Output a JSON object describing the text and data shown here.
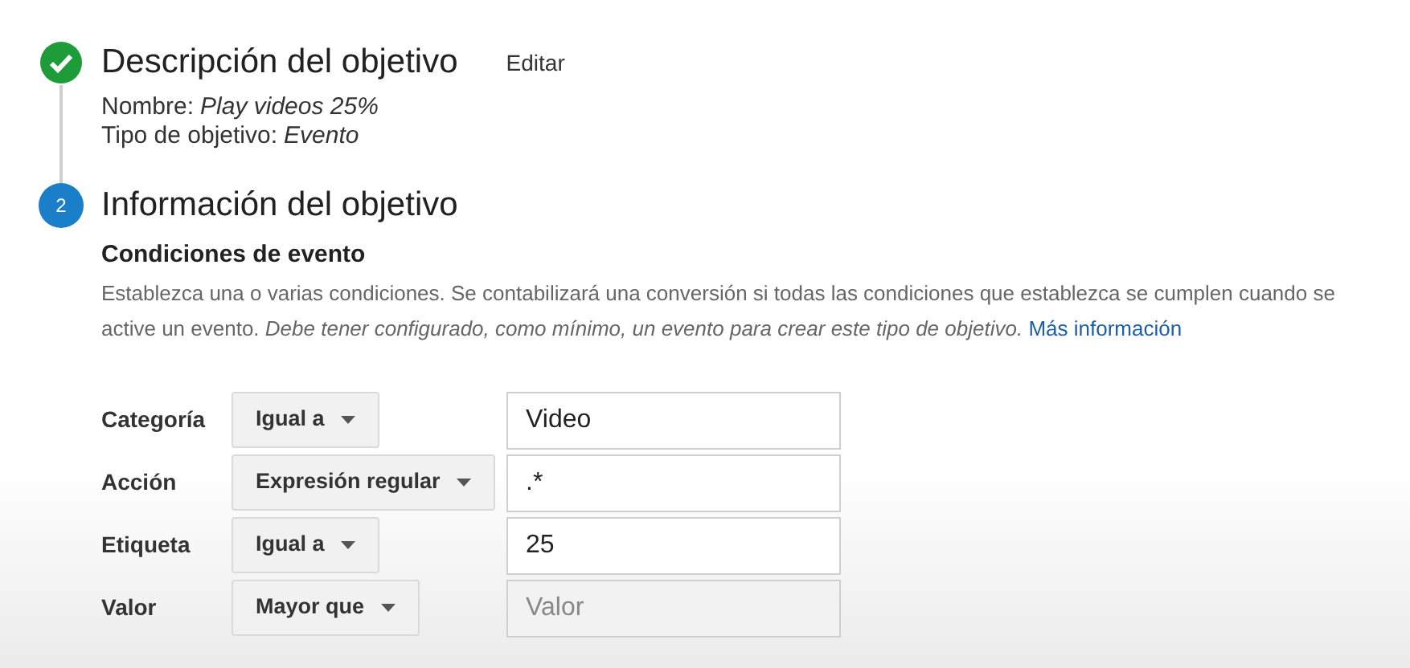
{
  "steps": [
    {
      "kind": "done",
      "title": "Descripción del objetivo",
      "action": "Editar",
      "details": [
        {
          "label": "Nombre:",
          "value": "Play videos 25%"
        },
        {
          "label": "Tipo de objetivo:",
          "value": "Evento"
        }
      ]
    },
    {
      "kind": "number",
      "marker": "2",
      "title": "Información del objetivo"
    }
  ],
  "conditions": {
    "heading": "Condiciones de evento",
    "description": "Establezca una o varias condiciones. Se contabilizará una conversión si todas las condiciones que establezca se cumplen cuando se active un evento. *Debe tener configurado, como mínimo, un evento para crear este tipo de objetivo.*",
    "link": "Más información",
    "rows": [
      {
        "label": "Categoría",
        "operator": "Igual a",
        "value": "Video"
      },
      {
        "label": "Acción",
        "operator": "Expresión regular",
        "value": ".*"
      },
      {
        "label": "Etiqueta",
        "operator": "Igual a",
        "value": "25"
      },
      {
        "label": "Valor",
        "operator": "Mayor que",
        "placeholder": "Valor"
      }
    ]
  }
}
